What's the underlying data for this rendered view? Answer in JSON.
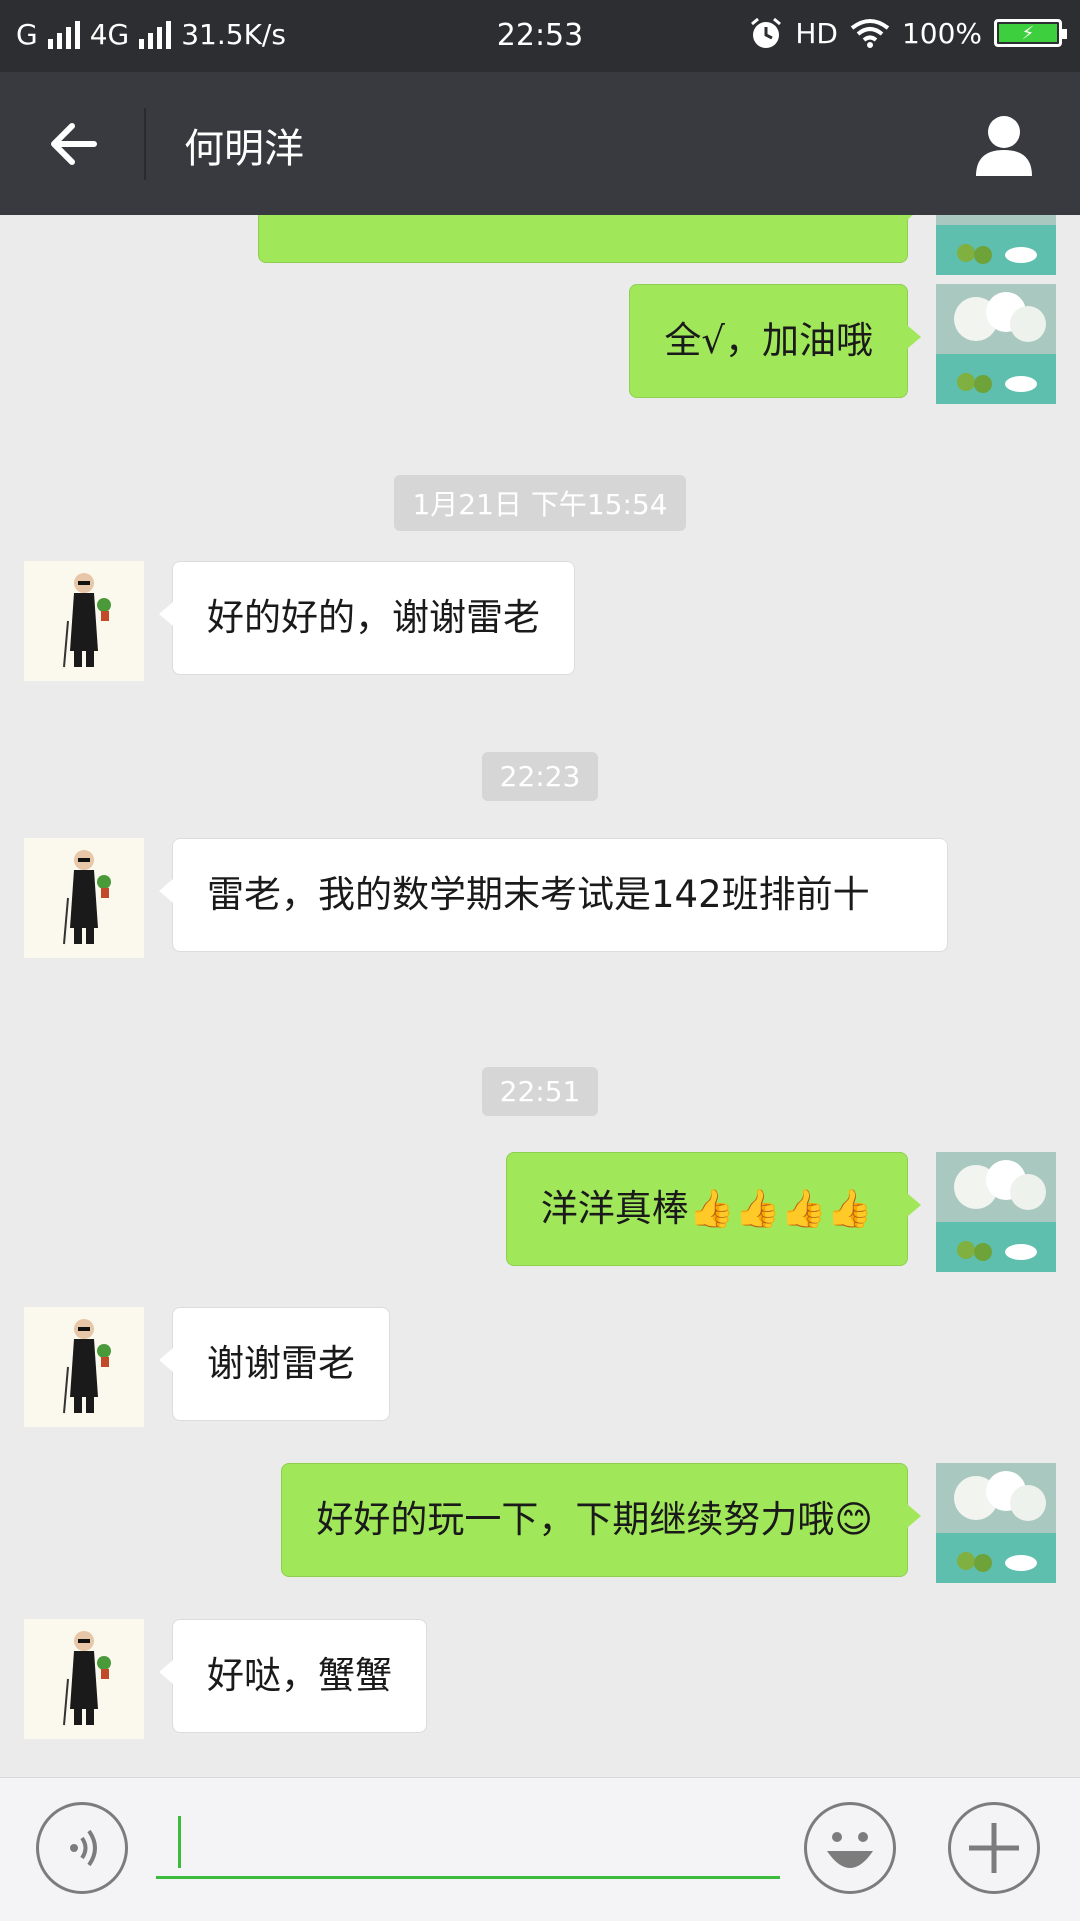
{
  "status_bar": {
    "carrier": "G",
    "network": "4G",
    "speed": "31.5K/s",
    "time": "22:53",
    "hd": "HD",
    "battery": "100%"
  },
  "header": {
    "title": "何明洋"
  },
  "messages": [
    {
      "type": "partial_self"
    },
    {
      "type": "self",
      "text": "全√，加油哦"
    },
    {
      "type": "timestamp",
      "text": "1月21日 下午15:54"
    },
    {
      "type": "other",
      "text": "好的好的，谢谢雷老"
    },
    {
      "type": "timestamp",
      "text": "22:23"
    },
    {
      "type": "other",
      "text": "雷老，我的数学期末考试是142班排前十"
    },
    {
      "type": "timestamp",
      "text": "22:51"
    },
    {
      "type": "self",
      "text": "洋洋真棒👍👍👍👍"
    },
    {
      "type": "other",
      "text": "谢谢雷老"
    },
    {
      "type": "self",
      "text": "好好的玩一下，下期继续努力哦😊"
    },
    {
      "type": "other",
      "text": "好哒，蟹蟹"
    }
  ],
  "colors": {
    "self_bubble": "#a0e75a",
    "other_bubble": "#ffffff",
    "nav_bg": "#393a3f",
    "accent": "#3cbb3c"
  },
  "icons": {
    "back": "arrow-left-icon",
    "profile": "person-icon",
    "voice": "voice-icon",
    "emoji": "emoji-icon",
    "more": "plus-icon"
  }
}
